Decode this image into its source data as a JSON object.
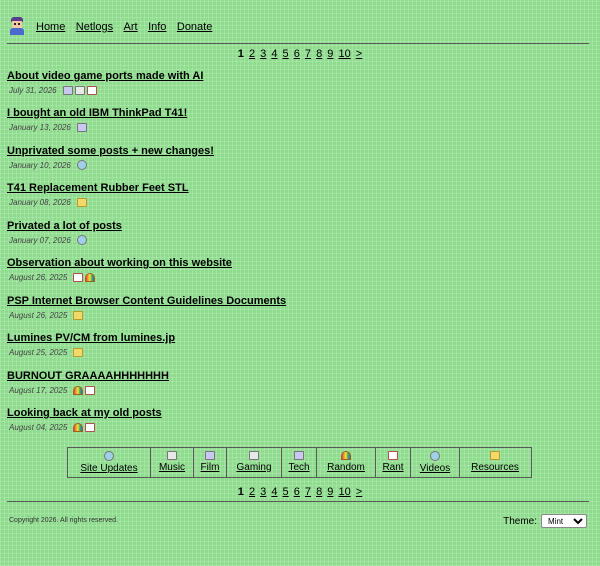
{
  "nav": {
    "items": [
      {
        "label": "Home"
      },
      {
        "label": "Netlogs"
      },
      {
        "label": "Art"
      },
      {
        "label": "Info"
      },
      {
        "label": "Donate"
      }
    ]
  },
  "pagination": {
    "pages": [
      "1",
      "2",
      "3",
      "4",
      "5",
      "6",
      "7",
      "8",
      "9",
      "10"
    ],
    "current": "1",
    "next_label": ">"
  },
  "posts": [
    {
      "title": "About video game ports made with AI",
      "date": "July 31, 2026",
      "tags": [
        "tech-icon",
        "gaming-icon",
        "rant-icon"
      ]
    },
    {
      "title": "I bought an old IBM ThinkPad T41!",
      "date": "January 13, 2026",
      "tags": [
        "tech-icon"
      ]
    },
    {
      "title": "Unprivated some posts + new changes!",
      "date": "January 10, 2026",
      "tags": [
        "site-updates-icon"
      ]
    },
    {
      "title": "T41 Replacement Rubber Feet STL",
      "date": "January 08, 2026",
      "tags": [
        "resources-icon"
      ]
    },
    {
      "title": "Privated a lot of posts",
      "date": "January 07, 2026",
      "tags": [
        "site-updates-icon"
      ]
    },
    {
      "title": "Observation about working on this website",
      "date": "August 26, 2025",
      "tags": [
        "rant-icon",
        "random-icon"
      ]
    },
    {
      "title": "PSP Internet Browser Content Guidelines Documents",
      "date": "August 26, 2025",
      "tags": [
        "resources-icon"
      ]
    },
    {
      "title": "Lumines PV/CM from lumines.jp",
      "date": "August 25, 2025",
      "tags": [
        "resources-icon"
      ]
    },
    {
      "title": "BURNOUT GRAAAAHHHHHHH",
      "date": "August 17, 2025",
      "tags": [
        "random-icon",
        "rant-icon"
      ]
    },
    {
      "title": "Looking back at my old posts",
      "date": "August 04, 2025",
      "tags": [
        "random-icon",
        "rant-icon"
      ]
    }
  ],
  "categories": [
    {
      "label": "Site Updates",
      "icon": "site-updates-icon"
    },
    {
      "label": "Music",
      "icon": "music-icon"
    },
    {
      "label": "Film",
      "icon": "film-icon"
    },
    {
      "label": "Gaming",
      "icon": "gaming-icon"
    },
    {
      "label": "Tech",
      "icon": "tech-icon"
    },
    {
      "label": "Random",
      "icon": "random-icon"
    },
    {
      "label": "Rant",
      "icon": "rant-icon"
    },
    {
      "label": "Videos",
      "icon": "videos-icon"
    },
    {
      "label": "Resources",
      "icon": "resources-icon"
    }
  ],
  "footer": {
    "copyright": "Copyright 2026. All rights reserved.",
    "theme_label": "Theme:",
    "theme_value": "Mint"
  },
  "colors": {
    "background": "#8fdc8f",
    "rule": "#5a5a5a"
  }
}
